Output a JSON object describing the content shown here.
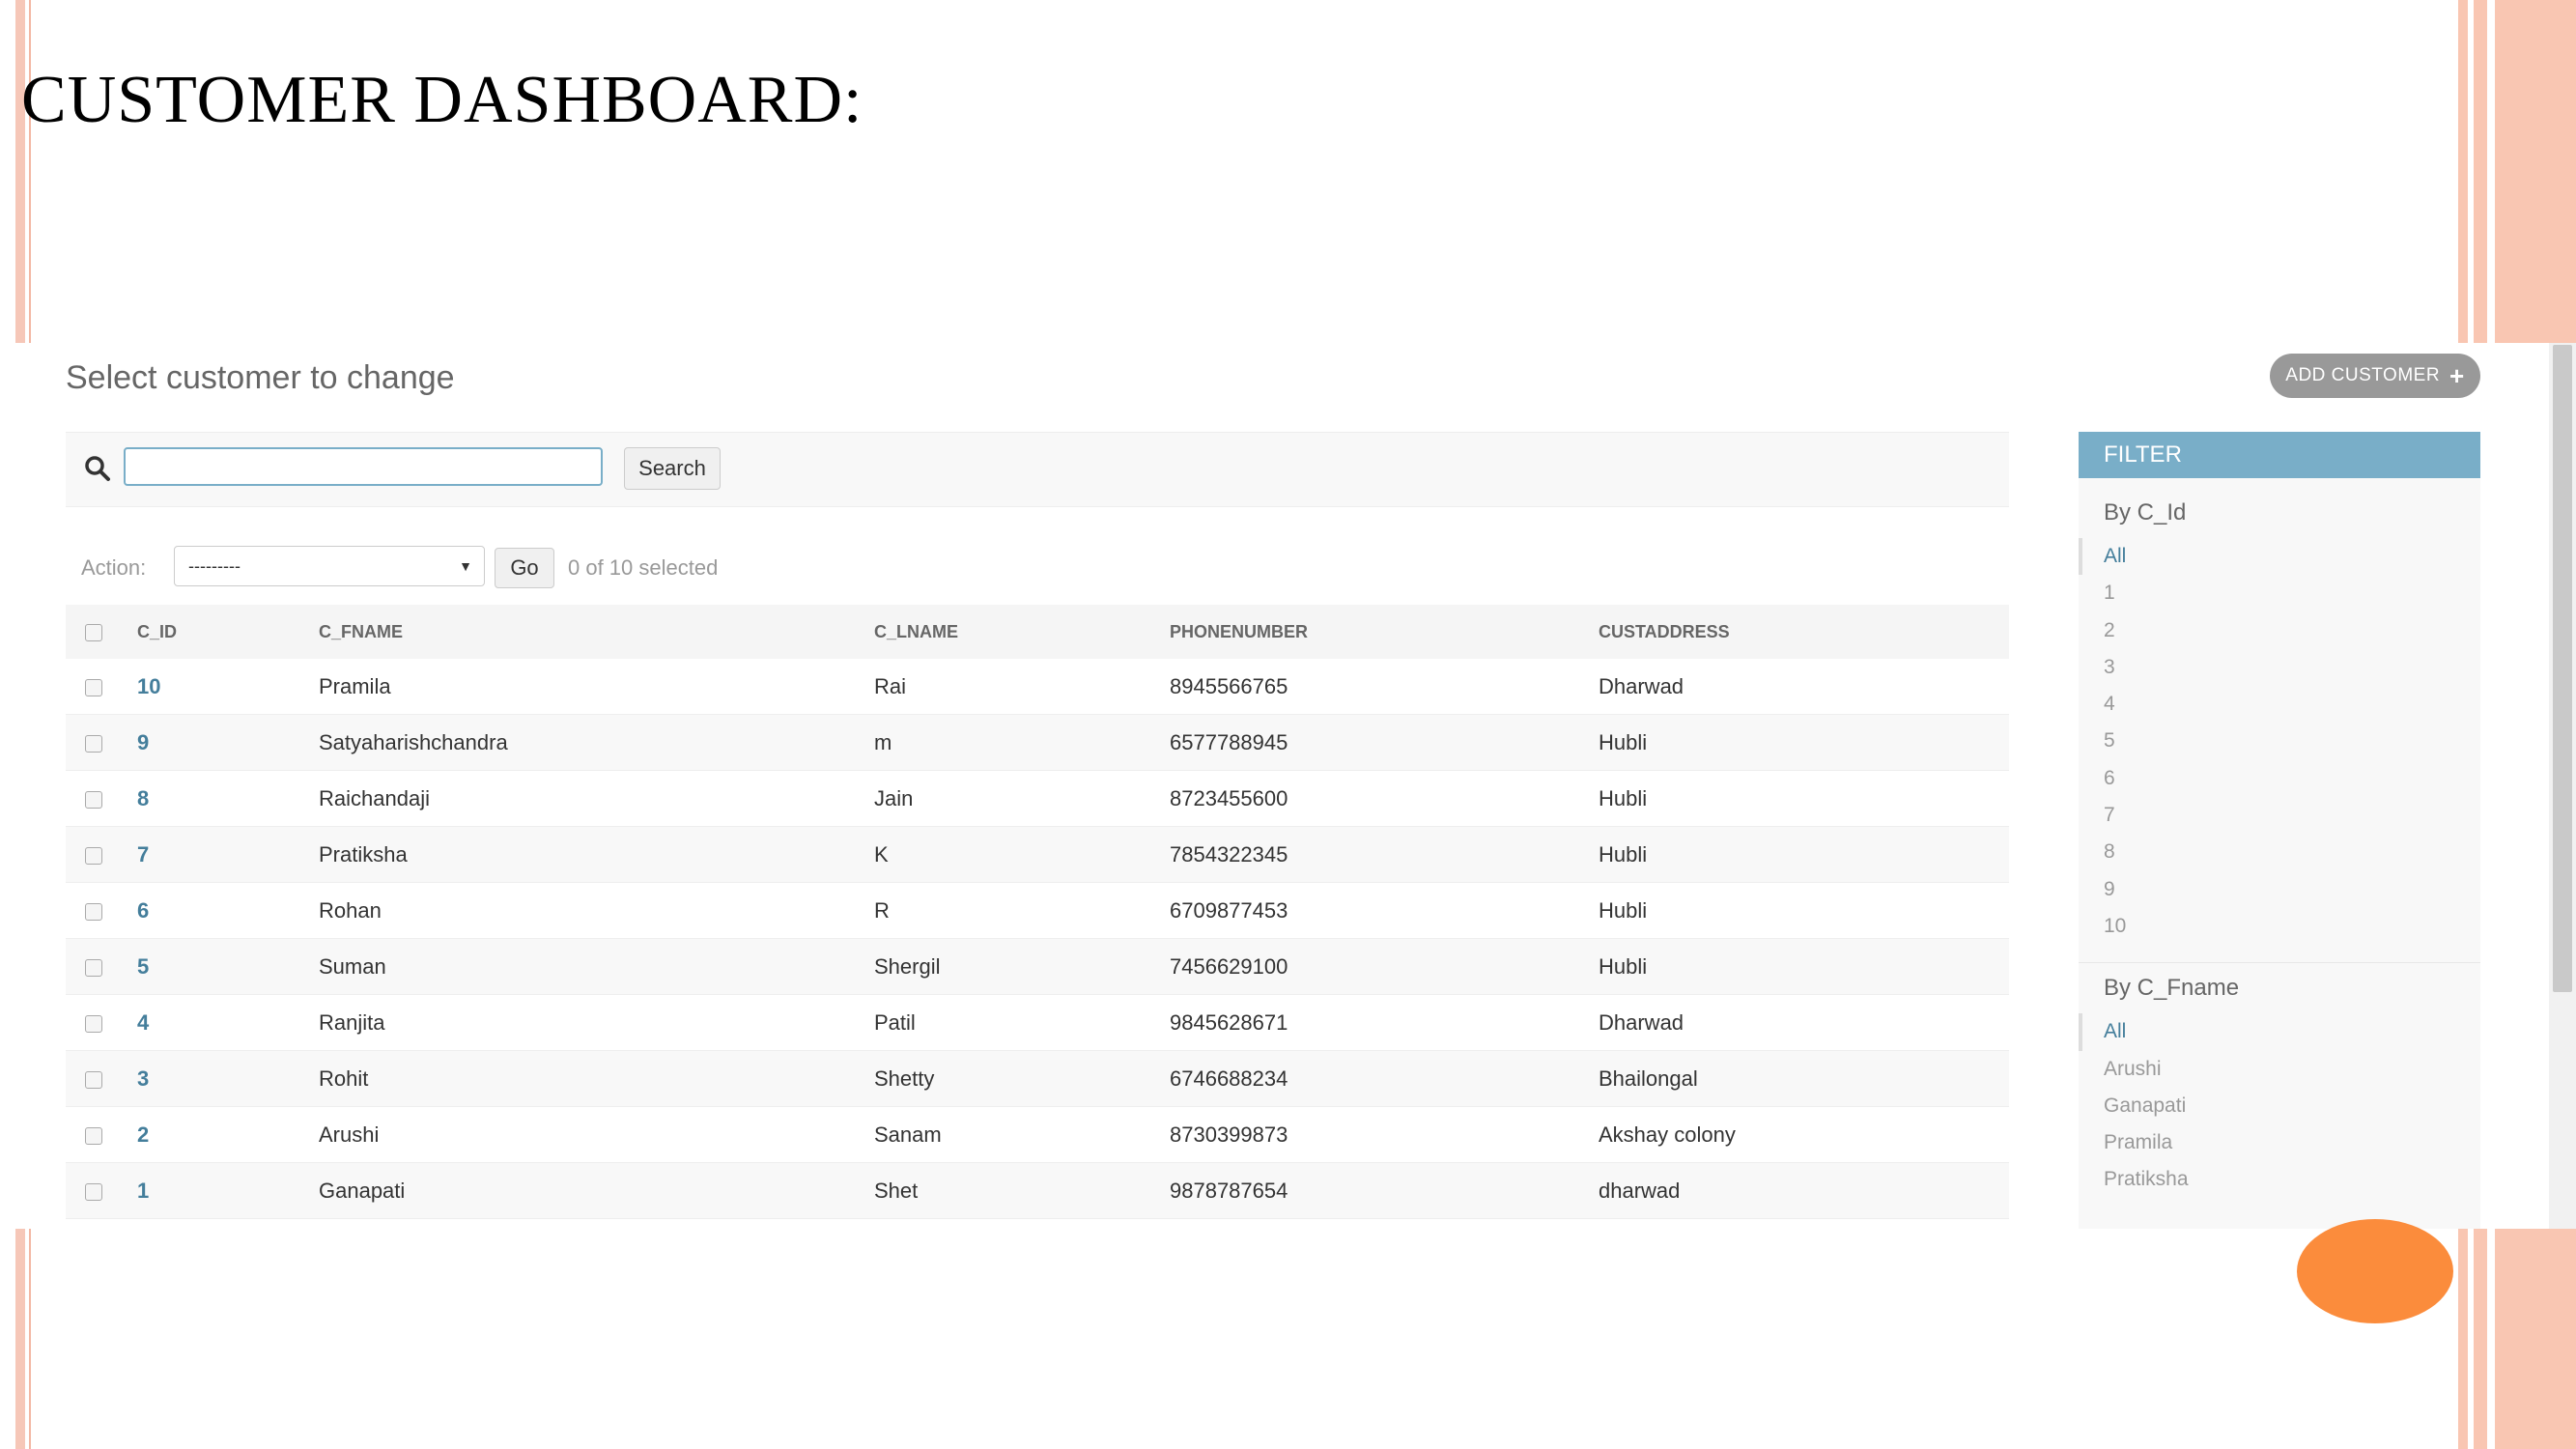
{
  "slide": {
    "title": "CUSTOMER DASHBOARD:"
  },
  "admin": {
    "page_title": "Select customer to change",
    "add_button_label": "ADD CUSTOMER",
    "search": {
      "value": "",
      "button_label": "Search"
    },
    "actions": {
      "label": "Action:",
      "selected_option": "---------",
      "go_label": "Go",
      "selected_count": "0 of 10 selected"
    },
    "table": {
      "columns": [
        "C_ID",
        "C_FNAME",
        "C_LNAME",
        "PHONENUMBER",
        "CUSTADDRESS"
      ],
      "rows": [
        [
          "10",
          "Pramila",
          "Rai",
          "8945566765",
          "Dharwad"
        ],
        [
          "9",
          "Satyaharishchandra",
          "m",
          "6577788945",
          "Hubli"
        ],
        [
          "8",
          "Raichandaji",
          "Jain",
          "8723455600",
          "Hubli"
        ],
        [
          "7",
          "Pratiksha",
          "K",
          "7854322345",
          "Hubli"
        ],
        [
          "6",
          "Rohan",
          "R",
          "6709877453",
          "Hubli"
        ],
        [
          "5",
          "Suman",
          "Shergil",
          "7456629100",
          "Hubli"
        ],
        [
          "4",
          "Ranjita",
          "Patil",
          "9845628671",
          "Dharwad"
        ],
        [
          "3",
          "Rohit",
          "Shetty",
          "6746688234",
          "Bhailongal"
        ],
        [
          "2",
          "Arushi",
          "Sanam",
          "8730399873",
          "Akshay colony"
        ],
        [
          "1",
          "Ganapati",
          "Shet",
          "9878787654",
          "dharwad"
        ]
      ]
    },
    "filter": {
      "title": "FILTER",
      "groups": [
        {
          "title": "By C_Id",
          "items": [
            "All",
            "1",
            "2",
            "3",
            "4",
            "5",
            "6",
            "7",
            "8",
            "9",
            "10"
          ]
        },
        {
          "title": "By C_Fname",
          "items": [
            "All",
            "Arushi",
            "Ganapati",
            "Pramila",
            "Pratiksha"
          ]
        }
      ]
    }
  },
  "colors": {
    "accent_blue": "#79aec8",
    "link_blue": "#447e9b",
    "slide_border": "#f6c7b8",
    "orange_oval": "#fb8c3c"
  }
}
